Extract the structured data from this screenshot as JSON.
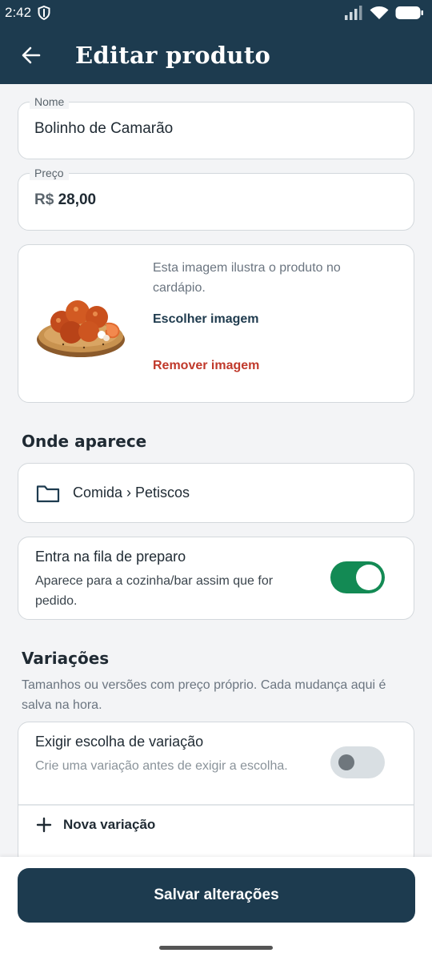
{
  "status_bar": {
    "time": "2:42"
  },
  "app_bar": {
    "title": "Editar produto"
  },
  "form": {
    "name_label": "Nome",
    "name_value": "Bolinho de Camarão",
    "price_label": "Preço",
    "price_prefix": "R$",
    "price_value": "28,00"
  },
  "image_card": {
    "description": "Esta imagem ilustra o produto no cardápio.",
    "choose_label": "Escolher imagem",
    "remove_label": "Remover imagem"
  },
  "where_section": {
    "title": "Onde aparece",
    "category_path": "Comida › Petiscos"
  },
  "prep_queue": {
    "title": "Entra na fila de preparo",
    "description": "Aparece para a cozinha/bar assim que for pedido.",
    "enabled": true
  },
  "variations": {
    "title": "Variações",
    "description": "Tamanhos ou versões com preço próprio. Cada mudança aqui é salva na hora.",
    "require_title": "Exigir escolha de variação",
    "require_hint": "Crie uma variação antes de exigir a escolha.",
    "require_enabled": false,
    "new_label": "Nova variação"
  },
  "footer": {
    "save_label": "Salvar alterações"
  },
  "colors": {
    "primary": "#1d3b4f",
    "toggle_on": "#138a54",
    "danger": "#c0392b",
    "background": "#f3f4f6"
  },
  "icons": [
    "back-arrow-icon",
    "shield-icon",
    "signal-icon",
    "wifi-icon",
    "battery-icon",
    "folder-icon",
    "plus-icon"
  ]
}
